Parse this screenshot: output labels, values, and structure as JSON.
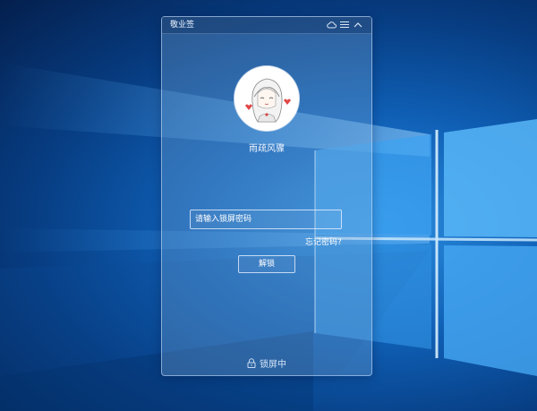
{
  "app": {
    "title": "敬业签"
  },
  "titlebar_icons": [
    "cloud-icon",
    "menu-icon",
    "collapse-icon"
  ],
  "user": {
    "name": "雨疏风骤",
    "avatar": "anime-girl-avatar"
  },
  "lock_form": {
    "password_placeholder": "请输入锁屏密码",
    "password_value": "",
    "forgot_link": "忘记密码?",
    "unlock_button": "解锁"
  },
  "status": {
    "icon": "lock-icon",
    "text": "锁屏中"
  },
  "colors": {
    "desktop_bg": "#0f5fb5",
    "panel_border": "#d2e6ff",
    "text": "#ffffff",
    "heart": "#e04848"
  }
}
